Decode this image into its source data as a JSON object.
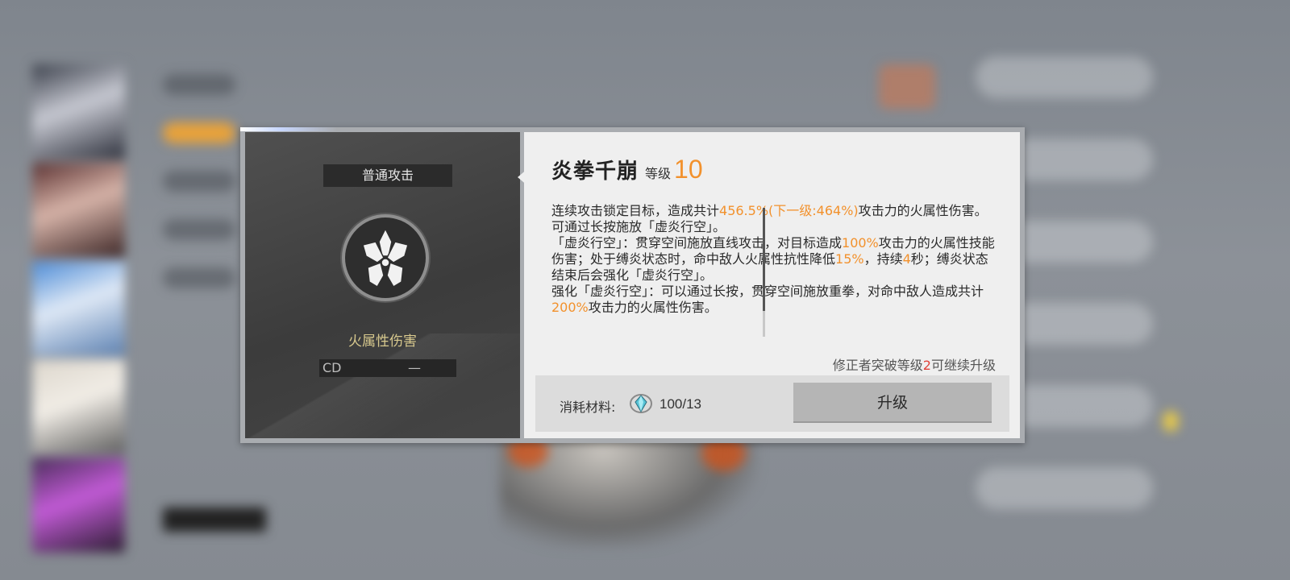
{
  "skill_panel": {
    "type_tag": "普通攻击",
    "element": "火属性伤害",
    "cd_label": "CD",
    "cd_value": "—",
    "icon": "crossed-fists-icon"
  },
  "skill_detail": {
    "name": "炎拳千崩",
    "level_label": "等级",
    "level_value": "10",
    "description": [
      {
        "segments": [
          {
            "text": "连续攻击锁定目标，造成共计",
            "hl": false
          },
          {
            "text": "456.5%(下一级:464%)",
            "hl": true
          },
          {
            "text": "攻击力的火属性伤害。",
            "hl": false
          }
        ]
      },
      {
        "segments": [
          {
            "text": "可通过长按施放「虚炎行空」。",
            "hl": false
          }
        ]
      },
      {
        "segments": [
          {
            "text": "「虚炎行空」：贯穿空间施放直线攻击，对目标造成",
            "hl": false
          },
          {
            "text": "100%",
            "hl": true
          },
          {
            "text": "攻击力的火属性技能伤害；处于缚炎状态时，命中敌人火属性抗性降低",
            "hl": false
          },
          {
            "text": "15%",
            "hl": true
          },
          {
            "text": "，持续",
            "hl": false
          },
          {
            "text": "4",
            "hl": true
          },
          {
            "text": "秒；缚炎状态结束后会强化「虚炎行空」。",
            "hl": false
          }
        ]
      },
      {
        "segments": [
          {
            "text": "强化「虚炎行空」：可以通过长按，贯穿空间施放重拳，对命中敌人造成共计",
            "hl": false
          },
          {
            "text": "200%",
            "hl": true
          },
          {
            "text": "攻击力的火属性伤害。",
            "hl": false
          }
        ]
      }
    ],
    "upgrade_note_prefix": "修正者突破等级",
    "upgrade_note_level": "2",
    "upgrade_note_suffix": "可继续升级"
  },
  "cost": {
    "label": "消耗材料:",
    "material_icon": "crystal-material-icon",
    "count": "100/13",
    "upgrade_button": "升级"
  },
  "colors": {
    "accent_orange": "#f2912c",
    "warning_red": "#e0433a",
    "panel_dark": "#3c3c3c",
    "panel_light": "#efefef"
  }
}
